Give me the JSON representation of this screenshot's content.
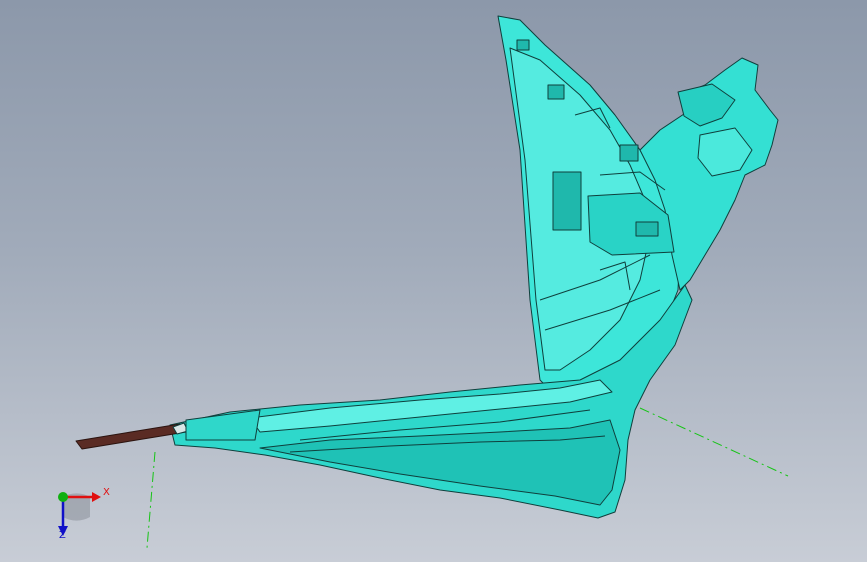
{
  "viewport": {
    "background_top": "#8c98aa",
    "background_bottom": "#c8cdd6",
    "part_color": "#2fe0d2",
    "part_edge_color": "#0f3f3c",
    "stub_color": "#5a2b24",
    "construction_line_color": "#16c416"
  },
  "triad": {
    "x_label": "X",
    "z_label": "Z",
    "x_color": "#e01010",
    "y_color": "#10b010",
    "z_color": "#1010c8"
  }
}
